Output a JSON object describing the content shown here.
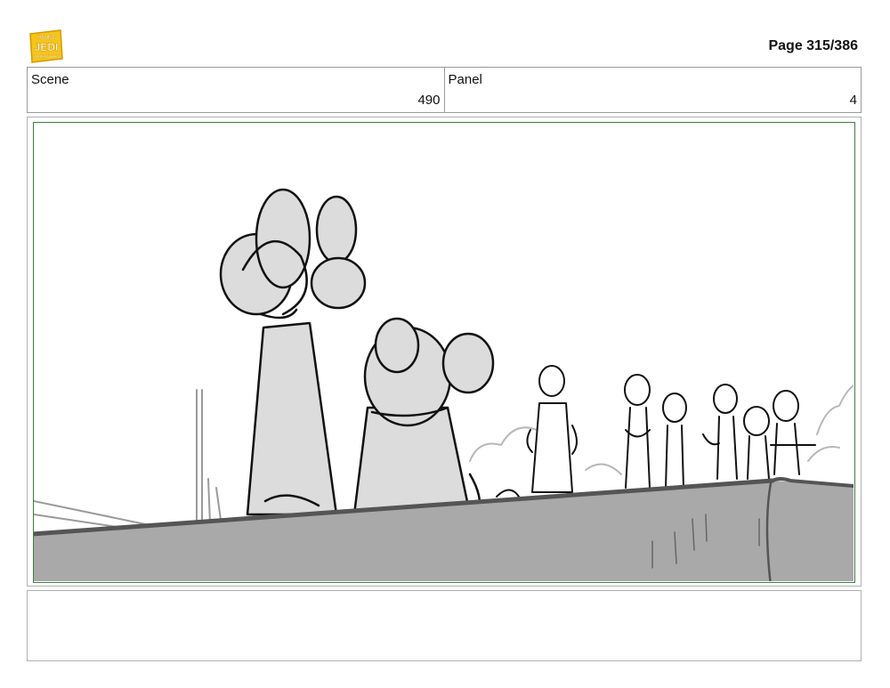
{
  "header": {
    "logo_lines": [
      "YOUNG",
      "JEDI",
      "ADVENTURES"
    ],
    "page_label": "Page 315/386"
  },
  "info": {
    "scene_label": "Scene",
    "scene_value": "490",
    "panel_label": "Panel",
    "panel_value": "4"
  },
  "notes": {
    "text": ""
  },
  "colors": {
    "frame_border": "#3f7d3f",
    "logo_yellow": "#f5c518",
    "ledge_gray": "#a9a9a9"
  }
}
